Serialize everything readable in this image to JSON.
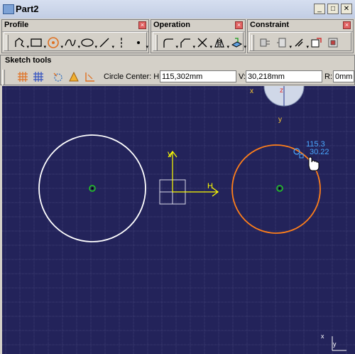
{
  "window": {
    "title": "Part2"
  },
  "toolbars": {
    "profile": {
      "title": "Profile",
      "tools": [
        "profile-tool",
        "rectangle-tool",
        "circle-tool",
        "spline-tool",
        "ellipse-tool",
        "line-tool",
        "axis-tool",
        "point-tool"
      ]
    },
    "operation": {
      "title": "Operation",
      "tools": [
        "corner-tool",
        "chamfer-tool",
        "trim-tool",
        "mirror-tool",
        "project-3d-tool"
      ]
    },
    "constraint": {
      "title": "Constraint",
      "tools": [
        "constraint-dialog-tool",
        "constraint-tool",
        "anchor-tool",
        "auto-constraint-tool",
        "animate-constraint-tool"
      ]
    }
  },
  "sketch_tools": {
    "title": "Sketch tools",
    "prompt": "Circle Center: H:",
    "h_value": "115,302mm",
    "v_label": "V:",
    "v_value": "30,218mm",
    "r_label": "R:",
    "r_value": "0mm"
  },
  "canvas": {
    "background": "#23235a",
    "axis_h_label": "H",
    "axis_v_label": "V",
    "cursor_h_readout": "115.3",
    "cursor_v_readout": "30.22",
    "compass_labels": {
      "x": "x",
      "y": "y",
      "z": "z"
    },
    "triad_labels": {
      "x": "x",
      "y": "y"
    },
    "colors": {
      "existing_circle": "#ffffff",
      "preview_circle": "#ff7f1a",
      "axis": "#ffff00",
      "readout": "#4aa8ff"
    }
  }
}
